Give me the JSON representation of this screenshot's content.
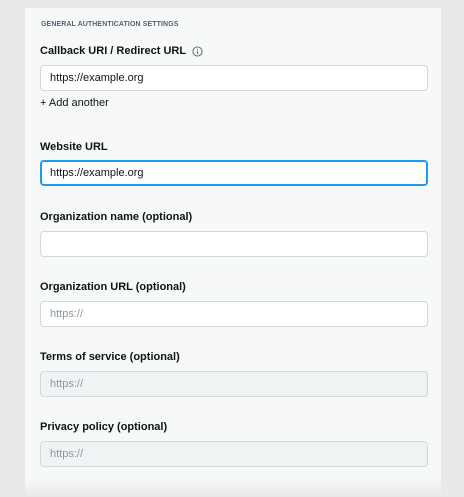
{
  "section": {
    "title": "GENERAL AUTHENTICATION SETTINGS"
  },
  "callback": {
    "label": "Callback URI / Redirect URL",
    "value": "https://example.org",
    "add_another": "+ Add another",
    "info_icon": "info-icon"
  },
  "website": {
    "label": "Website URL",
    "value": "https://example.org"
  },
  "organization_name": {
    "label": "Organization name (optional)",
    "value": ""
  },
  "organization_url": {
    "label": "Organization URL (optional)",
    "placeholder": "https://"
  },
  "terms": {
    "label": "Terms of service (optional)",
    "placeholder": "https://"
  },
  "privacy": {
    "label": "Privacy policy (optional)",
    "placeholder": "https://"
  },
  "colors": {
    "focus_border": "#1d9bf0",
    "field_border": "#cfd9de",
    "disabled_bg": "#eff3f4",
    "placeholder": "#8b98a5"
  }
}
